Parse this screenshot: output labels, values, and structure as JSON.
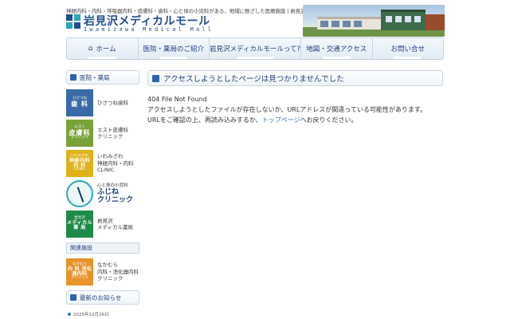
{
  "header": {
    "tagline": "神経内科・内科・呼吸器内科・皮膚科・歯科・心と体の小児科がある、地域に根ざした医療施設 | 岩見沢メディカルモール",
    "logo_title": "岩見沢メディカルモール",
    "logo_subtitle": "Iwamizawa Medical Mall"
  },
  "nav": {
    "items": [
      {
        "label": "ホーム",
        "icon": "home-icon"
      },
      {
        "label": "医院・薬局のご紹介"
      },
      {
        "label": "岩見沢メディカルモールって?"
      },
      {
        "label": "地図・交通アクセス"
      },
      {
        "label": "お問い合せ"
      }
    ]
  },
  "sidebar": {
    "clinics_heading": "医院・薬局",
    "clinics": [
      {
        "badge_small": "ひさつね",
        "badge_big": "歯 科",
        "name": "ひさつね歯科",
        "color": "#3b6aa8"
      },
      {
        "badge_small": "エスト",
        "badge_big": "皮膚科",
        "badge_foot": "クリニック",
        "name1": "エスト皮膚科",
        "name2": "クリニック",
        "color": "#7aa23a"
      },
      {
        "badge_small": "いわみざわ",
        "badge_big": "神経内科 内 科",
        "badge_foot": "CLINIC",
        "name1": "いわみざわ",
        "name2": "神経内科・内科",
        "name3": "CLINIC",
        "color": "#e0b21a"
      },
      {
        "small": "心と体の小児科",
        "big1": "ふじね",
        "big2": "クリニック"
      },
      {
        "badge_small": "岩見沢",
        "badge_big": "メディカル 薬 局",
        "name1": "岩見沢",
        "name2": "メディカル薬局",
        "color": "#1f8a4a"
      }
    ],
    "related_heading": "関連施設",
    "related": {
      "badge_small": "なかむら",
      "badge_big": "内 科 消化器内科",
      "badge_foot": "クリニック",
      "name1": "なかむら",
      "name2": "内科・消化器内科",
      "name3": "クリニック",
      "color": "#e8922a"
    },
    "news_heading": "最新のお知らせ",
    "news_date": "2025年12月26日"
  },
  "main": {
    "title": "アクセスしようとしたページは見つかりませんでした",
    "line1": "404 File Not Found",
    "line2": "アクセスしようとしたファイルが存在しないか、URLアドレスが間違っている可能性があります。",
    "line3_pre": "URLをご確認の上、再読み込みするか、",
    "line3_link": "トップページ",
    "line3_post": "へお戻りください。"
  }
}
